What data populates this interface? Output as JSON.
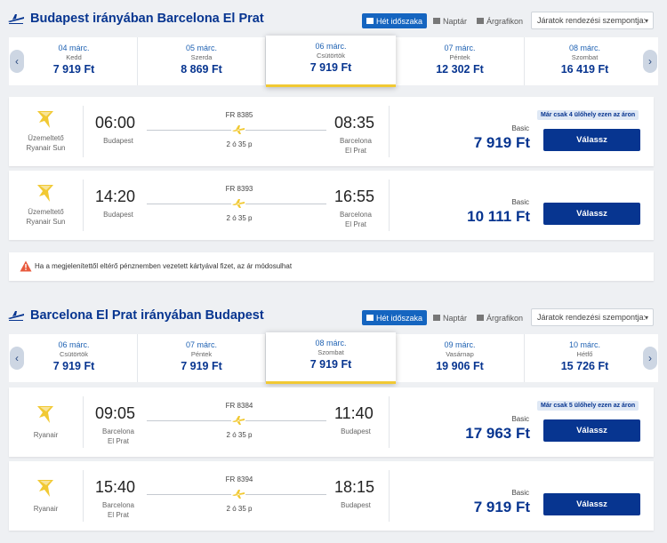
{
  "colors": {
    "brand": "#073590",
    "accent_yellow": "#f1c933",
    "view_active": "#1565c0"
  },
  "view_options": {
    "week": "Hét időszaka",
    "calendar": "Naptár",
    "price_chart": "Árgrafikon"
  },
  "sort_placeholder": "Járatok rendezési szempontja:",
  "sections": [
    {
      "title": "Budapest irányában Barcelona El Prat",
      "dates": [
        {
          "date": "04 márc.",
          "day": "Kedd",
          "price": "7 919 Ft"
        },
        {
          "date": "05 márc.",
          "day": "Szerda",
          "price": "8 869 Ft"
        },
        {
          "date": "06 márc.",
          "day": "Csütörtök",
          "price": "7 919 Ft"
        },
        {
          "date": "07 márc.",
          "day": "Péntek",
          "price": "12 302 Ft"
        },
        {
          "date": "08 márc.",
          "day": "Szombat",
          "price": "16 419 Ft"
        }
      ],
      "flights": [
        {
          "operator_line1": "Üzemeltető",
          "operator_line2": "Ryanair Sun",
          "dep_time": "06:00",
          "dep_city1": "Budapest",
          "dep_city2": "",
          "flight_no": "FR 8385",
          "duration": "2 ó 35 p",
          "arr_time": "08:35",
          "arr_city1": "Barcelona",
          "arr_city2": "El Prat",
          "seats": "Már csak 4 ülőhely ezen az áron",
          "fare": "Basic",
          "price": "7 919 Ft",
          "button": "Válassz"
        },
        {
          "operator_line1": "Üzemeltető",
          "operator_line2": "Ryanair Sun",
          "dep_time": "14:20",
          "dep_city1": "Budapest",
          "dep_city2": "",
          "flight_no": "FR 8393",
          "duration": "2 ó 35 p",
          "arr_time": "16:55",
          "arr_city1": "Barcelona",
          "arr_city2": "El Prat",
          "seats": "",
          "fare": "Basic",
          "price": "10 111 Ft",
          "button": "Válassz"
        }
      ]
    },
    {
      "title": "Barcelona El Prat irányában Budapest",
      "dates": [
        {
          "date": "06 márc.",
          "day": "Csütörtök",
          "price": "7 919 Ft"
        },
        {
          "date": "07 márc.",
          "day": "Péntek",
          "price": "7 919 Ft"
        },
        {
          "date": "08 márc.",
          "day": "Szombat",
          "price": "7 919 Ft"
        },
        {
          "date": "09 márc.",
          "day": "Vasárnap",
          "price": "19 906 Ft"
        },
        {
          "date": "10 márc.",
          "day": "Hétfő",
          "price": "15 726 Ft"
        }
      ],
      "flights": [
        {
          "operator_line1": "Ryanair",
          "operator_line2": "",
          "dep_time": "09:05",
          "dep_city1": "Barcelona",
          "dep_city2": "El Prat",
          "flight_no": "FR 8384",
          "duration": "2 ó 35 p",
          "arr_time": "11:40",
          "arr_city1": "Budapest",
          "arr_city2": "",
          "seats": "Már csak 5 ülőhely ezen az áron",
          "fare": "Basic",
          "price": "17 963 Ft",
          "button": "Válassz"
        },
        {
          "operator_line1": "Ryanair",
          "operator_line2": "",
          "dep_time": "15:40",
          "dep_city1": "Barcelona",
          "dep_city2": "El Prat",
          "flight_no": "FR 8394",
          "duration": "2 ó 35 p",
          "arr_time": "18:15",
          "arr_city1": "Budapest",
          "arr_city2": "",
          "seats": "",
          "fare": "Basic",
          "price": "7 919 Ft",
          "button": "Válassz"
        }
      ]
    }
  ],
  "notice": "Ha a megjelenítettől eltérő pénznemben vezetett kártyával fizet, az ár módosulhat"
}
